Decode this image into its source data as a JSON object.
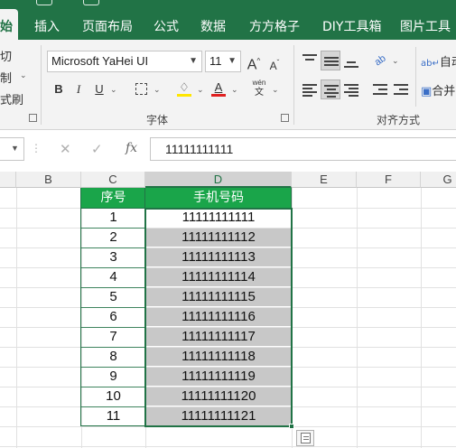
{
  "ribbon_tabs": [
    "始",
    "插入",
    "页面布局",
    "公式",
    "数据",
    "方方格子",
    "DIY工具箱",
    "图片工具"
  ],
  "clipboard": {
    "cut_label": "切",
    "copy_label": "制",
    "format_painter_label": "式刷"
  },
  "font": {
    "family": "Microsoft YaHei UI",
    "size": "11",
    "bold_label": "B",
    "italic_label": "I",
    "underline_label": "U",
    "group_name": "字体",
    "grow_label": "A",
    "shrink_label": "A",
    "font_color_label": "A",
    "phonetic_label": "wén",
    "phonetic_sub": "文"
  },
  "alignment": {
    "group_name": "对齐方式",
    "wrap_label": "自动",
    "merge_label": "合并",
    "orientation_label": "ab"
  },
  "formula_bar": {
    "fx_label": "fx",
    "value": "11111111111"
  },
  "columns": [
    "B",
    "C",
    "D",
    "E",
    "F",
    "G"
  ],
  "table": {
    "headers": [
      "序号",
      "手机号码"
    ],
    "rows": [
      [
        "1",
        "11111111111"
      ],
      [
        "2",
        "11111111112"
      ],
      [
        "3",
        "11111111113"
      ],
      [
        "4",
        "11111111114"
      ],
      [
        "5",
        "11111111115"
      ],
      [
        "6",
        "11111111116"
      ],
      [
        "7",
        "11111111117"
      ],
      [
        "8",
        "11111111118"
      ],
      [
        "9",
        "11111111119"
      ],
      [
        "10",
        "11111111120"
      ],
      [
        "11",
        "11111111121"
      ]
    ]
  },
  "colors": {
    "excel_green": "#217346",
    "header_fill": "#1aa54a",
    "selection_fill": "#c8c8c8",
    "font_color_bar": "#e02020",
    "highlight_bar": "#ffe600"
  },
  "icons": [
    "cut-icon",
    "copy-icon",
    "format-painter-icon",
    "borders-icon",
    "fill-color-icon",
    "font-color-icon",
    "cancel-icon",
    "enter-icon",
    "fx-icon",
    "paste-options-icon"
  ]
}
